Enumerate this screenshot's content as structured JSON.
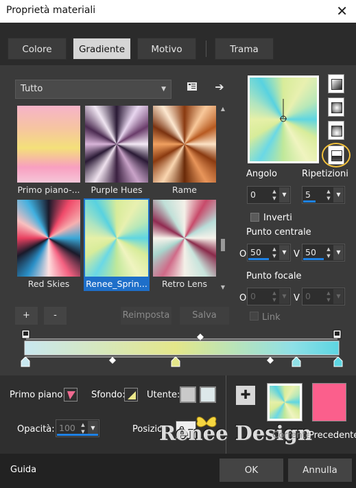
{
  "window": {
    "title": "Proprietà materiali",
    "close_glyph": "✕"
  },
  "tabs": [
    {
      "label": "Colore"
    },
    {
      "label": "Gradiente",
      "active": true
    },
    {
      "label": "Motivo"
    },
    {
      "label": "Trama"
    }
  ],
  "category": {
    "selected": "Tutto"
  },
  "gallery": {
    "items": [
      {
        "label": "Primo piano-...",
        "selected": false
      },
      {
        "label": "Purple Hues",
        "selected": false
      },
      {
        "label": "Rame",
        "selected": false
      },
      {
        "label": "Red Skies",
        "selected": false
      },
      {
        "label": "Renee_Sprin...",
        "selected": true
      },
      {
        "label": "Retro Lens",
        "selected": false
      }
    ]
  },
  "gallery_buttons": {
    "add": "+",
    "remove": "-",
    "reset": "Reimposta",
    "save": "Salva"
  },
  "settings": {
    "angle_label": "Angolo",
    "angle_value": "0",
    "repeats_label": "Ripetizioni",
    "repeats_value": "5",
    "invert_label": "Inverti",
    "center_label": "Punto centrale",
    "center_h_label": "O",
    "center_h": "50",
    "center_v_label": "V",
    "center_v": "50",
    "focal_label": "Punto focale",
    "focal_h_label": "O",
    "focal_h": "0",
    "focal_v_label": "V",
    "focal_v": "0",
    "link_label": "Link"
  },
  "gradient_stops": [
    {
      "color": "#c9e8f0"
    },
    {
      "color": "#e4e78a"
    },
    {
      "color": "#8fe0e6"
    },
    {
      "color": "#5dd6e2"
    }
  ],
  "materials": {
    "foreground_label": "Primo piano:",
    "background_label": "Sfondo:",
    "user_label": "Utente:",
    "opacity_label": "Opacità:",
    "opacity_value": "100",
    "position_label": "Posizio",
    "position_value": "0",
    "current_label": "Corrente",
    "previous_label": "Precedente",
    "previous_color": "#fb5f8c"
  },
  "watermark": "Renee Design",
  "footer": {
    "help": "Guida",
    "ok": "OK",
    "cancel": "Annulla"
  }
}
